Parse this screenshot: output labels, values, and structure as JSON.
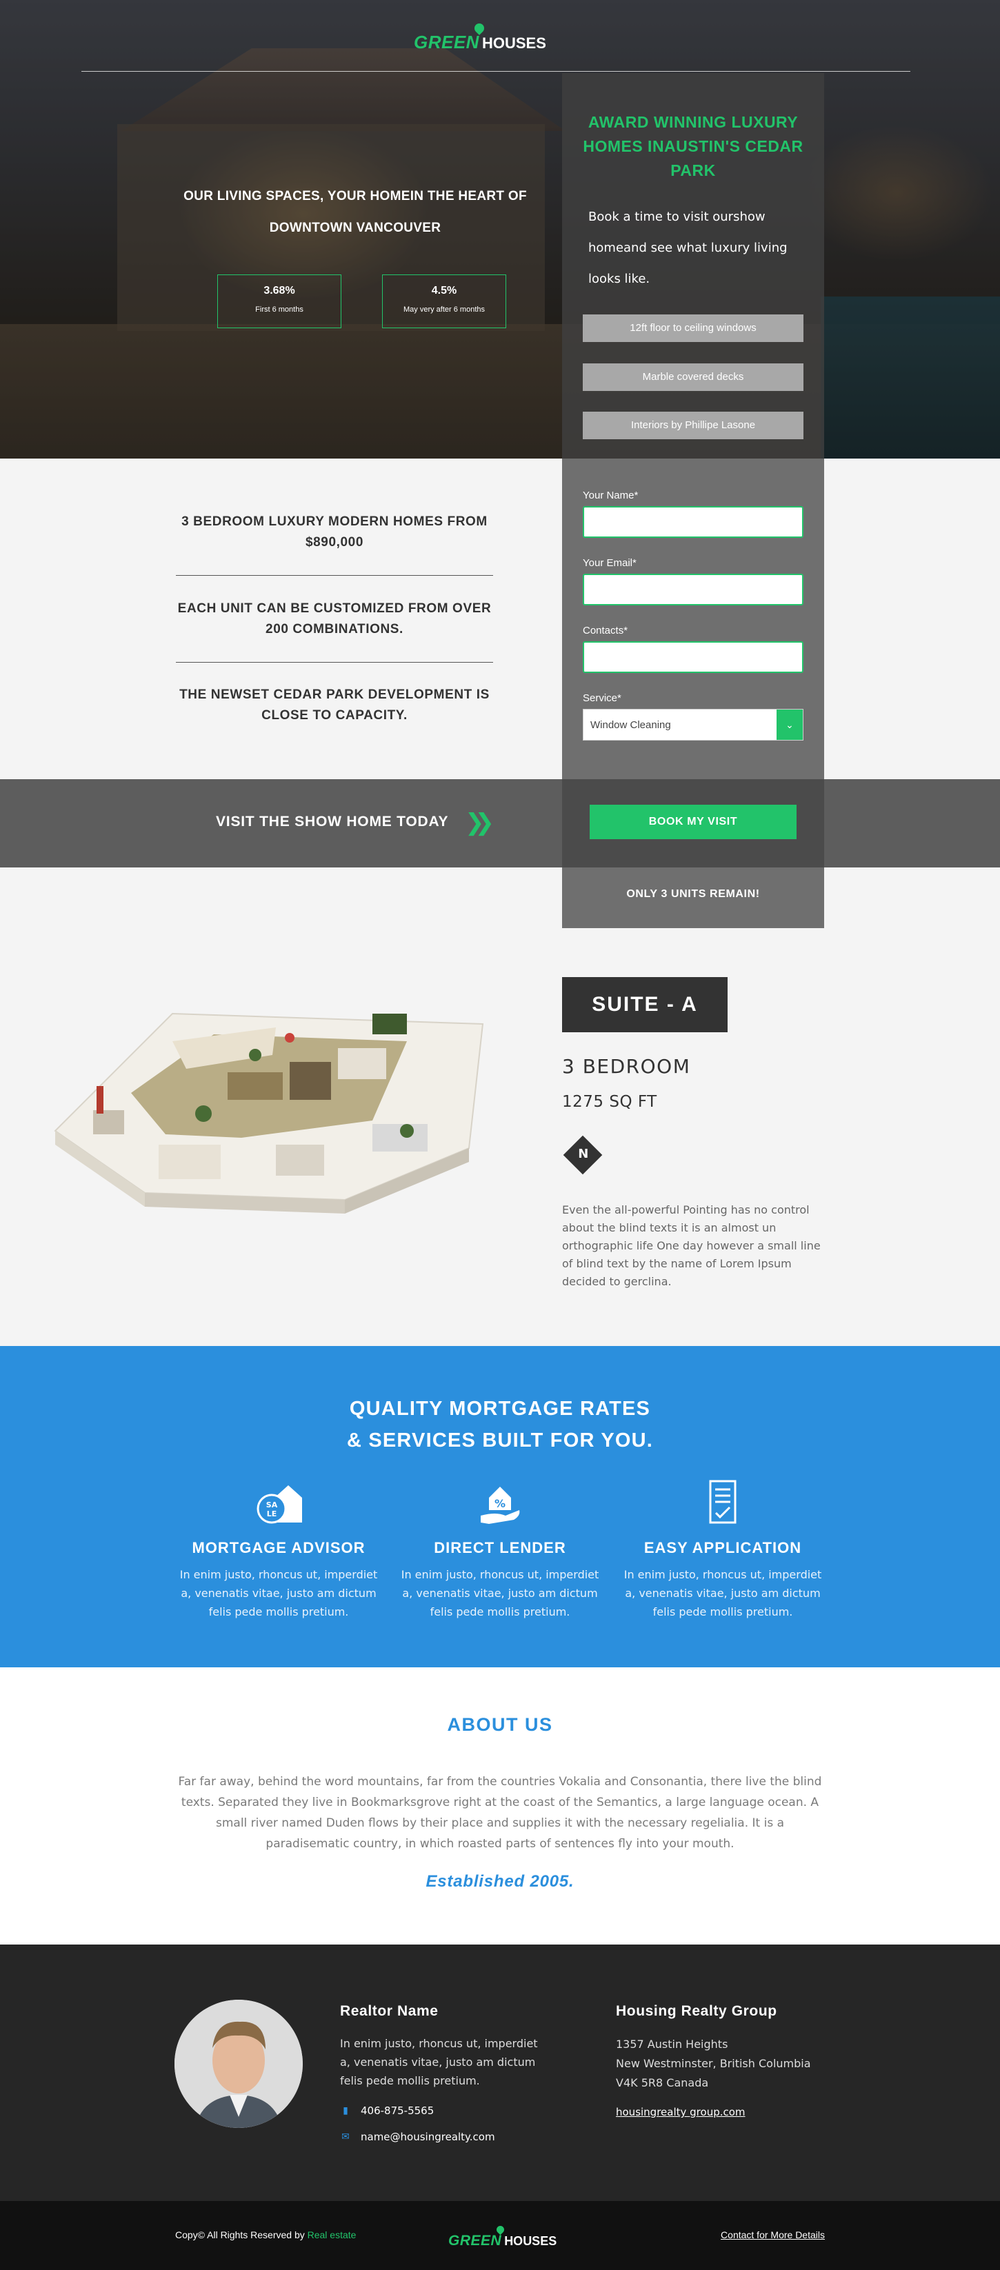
{
  "brand": {
    "logo_green": "GREEN",
    "logo_white": "HOUSES",
    "accent": "#22c36a",
    "blue": "#2b8fdd"
  },
  "hero": {
    "headline": "OUR LIVING SPACES, YOUR HOMEIN THE HEART OF DOWNTOWN VANCOUVER",
    "stats": [
      {
        "value": "3.68%",
        "caption": "First 6 months"
      },
      {
        "value": "4.5%",
        "caption": "May very after 6 months"
      }
    ]
  },
  "panel": {
    "title": "AWARD WINNING LUXURY HOMES INAUSTIN'S CEDAR PARK",
    "text": "Book a time to visit ourshow homeand see what luxury living looks like.",
    "features": [
      "12ft floor to ceiling windows",
      "Marble covered decks",
      "Interiors by Phillipe Lasone"
    ]
  },
  "features": [
    "3 BEDROOM LUXURY MODERN HOMES FROM $890,000",
    "EACH UNIT CAN BE CUSTOMIZED FROM OVER 200 COMBINATIONS.",
    "THE NEWSET CEDAR PARK DEVELOPMENT IS CLOSE TO CAPACITY."
  ],
  "form": {
    "name_label": "Your Name*",
    "email_label": "Your Email*",
    "contacts_label": "Contacts*",
    "service_label": "Service*",
    "service_value": "Window Cleaning"
  },
  "visit": {
    "text": "VISIT THE SHOW HOME TODAY",
    "arrow_icon": "double-chevron-right-icon",
    "button": "BOOK MY VISIT",
    "units": "ONLY 3 UNITS REMAIN!"
  },
  "suite": {
    "badge": "SUITE - A",
    "beds": "3 BEDROOM",
    "sqft": "1275 SQ FT",
    "compass": "N",
    "description": "Even the all-powerful Pointing has no control about the blind texts it is an almost un orthographic life One day however a small line of blind text by the name of Lorem Ipsum decided to gerclina."
  },
  "mortgage": {
    "title_line1": "QUALITY MORTGAGE RATES",
    "title_line2": "& SERVICES BUILT FOR YOU.",
    "columns": [
      {
        "icon": "sale-house-icon",
        "title": "MORTGAGE ADVISOR",
        "text": "In enim justo, rhoncus ut, imperdiet a, venenatis vitae, justo am dictum felis pede mollis pretium."
      },
      {
        "icon": "percent-house-hand-icon",
        "title": "DIRECT LENDER",
        "text": "In enim justo, rhoncus ut, imperdiet a, venenatis vitae, justo am dictum felis pede mollis pretium."
      },
      {
        "icon": "application-document-icon",
        "title": "EASY APPLICATION",
        "text": "In enim justo, rhoncus ut, imperdiet a, venenatis vitae, justo am dictum felis pede mollis pretium."
      }
    ]
  },
  "about": {
    "title": "ABOUT US",
    "text": "Far far away, behind the word mountains, far from the countries Vokalia and Consonantia, there live the blind texts. Separated they live in Bookmarksgrove right at the coast of the Semantics, a large language ocean. A small river named Duden flows by their place and supplies it with the necessary regelialia. It is a paradisematic country, in which roasted parts of sentences fly into your mouth.",
    "established": "Established 2005."
  },
  "contact": {
    "realtor_name": "Realtor Name",
    "realtor_bio": "In enim justo, rhoncus ut, imperdiet a, venenatis vitae, justo am dictum felis pede mollis pretium.",
    "phone": "406-875-5565",
    "email": "name@housingrealty.com",
    "group_name": "Housing Realty Group",
    "address_line1": "1357 Austin Heights",
    "address_line2": "New Westminster, British Columbia",
    "address_line3": "V4K 5R8 Canada",
    "website": "housingrealty group.com"
  },
  "footer": {
    "copyright": "Copy© All Rights Reserved by",
    "copyright_brand": "Real estate",
    "contact_link": "Contact for More Details"
  }
}
